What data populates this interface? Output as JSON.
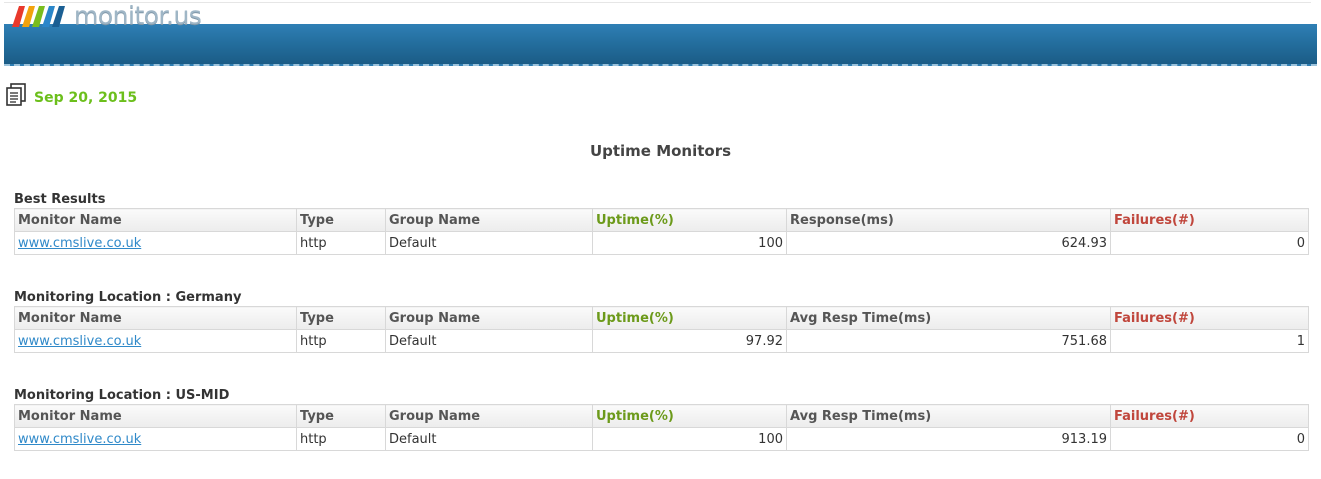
{
  "header": {
    "logo_text": "monitor.us",
    "icons": [
      "logo-icon",
      "report-icon"
    ]
  },
  "report": {
    "date": "Sep 20, 2015",
    "title": "Uptime Monitors"
  },
  "colors": {
    "date": "#6cbf1c",
    "uptime": "#6c9a1a",
    "failures": "#c0463c",
    "link": "#2f89c9",
    "banner": "#246f9f"
  },
  "sections": [
    {
      "title": "Best Results",
      "columns": [
        "Monitor Name",
        "Type",
        "Group Name",
        "Uptime(%)",
        "Response(ms)",
        "Failures(#)"
      ],
      "rows": [
        {
          "name": "www.cmslive.co.uk",
          "type": "http",
          "group": "Default",
          "uptime": "100",
          "response": "624.93",
          "failures": "0"
        }
      ]
    },
    {
      "title": "Monitoring Location : Germany",
      "columns": [
        "Monitor Name",
        "Type",
        "Group Name",
        "Uptime(%)",
        "Avg Resp Time(ms)",
        "Failures(#)"
      ],
      "rows": [
        {
          "name": "www.cmslive.co.uk",
          "type": "http",
          "group": "Default",
          "uptime": "97.92",
          "response": "751.68",
          "failures": "1"
        }
      ]
    },
    {
      "title": "Monitoring Location : US-MID",
      "columns": [
        "Monitor Name",
        "Type",
        "Group Name",
        "Uptime(%)",
        "Avg Resp Time(ms)",
        "Failures(#)"
      ],
      "rows": [
        {
          "name": "www.cmslive.co.uk",
          "type": "http",
          "group": "Default",
          "uptime": "100",
          "response": "913.19",
          "failures": "0"
        }
      ]
    }
  ]
}
